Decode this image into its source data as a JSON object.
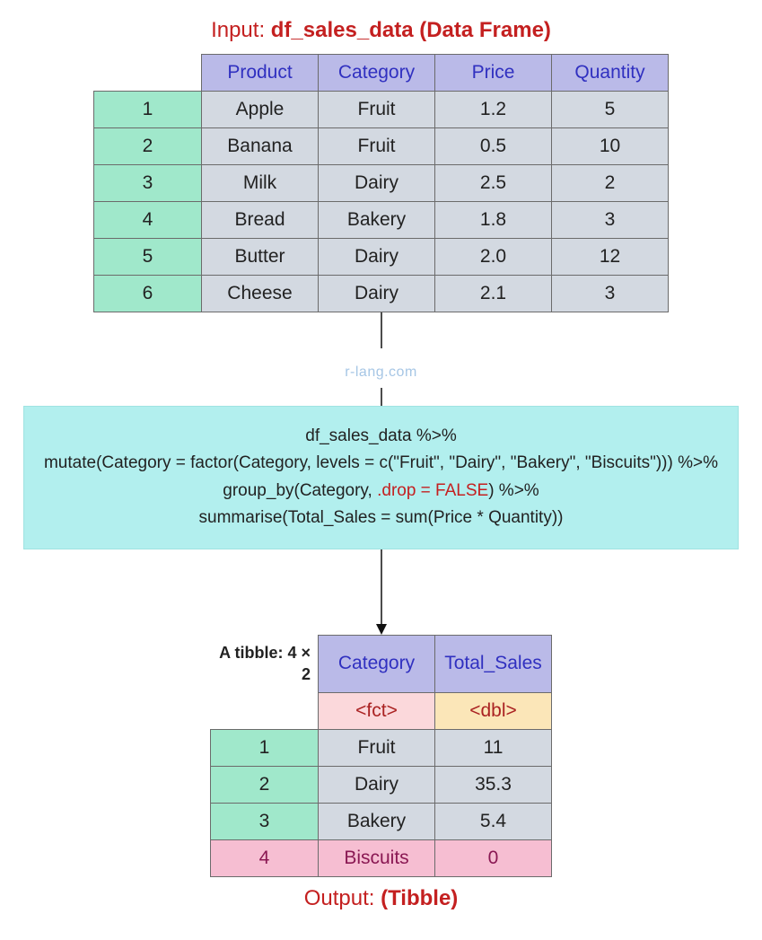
{
  "input": {
    "label": "Input: ",
    "name": "df_sales_data (Data Frame)",
    "headers": [
      "Product",
      "Category",
      "Price",
      "Quantity"
    ],
    "rows": [
      {
        "idx": "1",
        "cells": [
          "Apple",
          "Fruit",
          "1.2",
          "5"
        ]
      },
      {
        "idx": "2",
        "cells": [
          "Banana",
          "Fruit",
          "0.5",
          "10"
        ]
      },
      {
        "idx": "3",
        "cells": [
          "Milk",
          "Dairy",
          "2.5",
          "2"
        ]
      },
      {
        "idx": "4",
        "cells": [
          "Bread",
          "Bakery",
          "1.8",
          "3"
        ]
      },
      {
        "idx": "5",
        "cells": [
          "Butter",
          "Dairy",
          "2.0",
          "12"
        ]
      },
      {
        "idx": "6",
        "cells": [
          "Cheese",
          "Dairy",
          "2.1",
          "3"
        ]
      }
    ]
  },
  "watermark": "r-lang.com",
  "code": {
    "l1": "df_sales_data %>%",
    "l2a": "mutate(Category = factor(Category, levels = c(\"Fruit\", \"Dairy\", \"Bakery\", \"Biscuits\"))) %>%",
    "l3a": "group_by(Category, ",
    "l3b": ".drop = FALSE",
    "l3c": ") %>%",
    "l4": "summarise(Total_Sales = sum(Price * Quantity))"
  },
  "output": {
    "tibble_label": "A tibble: 4 × 2",
    "headers": [
      "Category",
      "Total_Sales"
    ],
    "types": [
      "<fct>",
      "<dbl>"
    ],
    "rows": [
      {
        "idx": "1",
        "cells": [
          "Fruit",
          "11"
        ],
        "pink": false
      },
      {
        "idx": "2",
        "cells": [
          "Dairy",
          "35.3"
        ],
        "pink": false
      },
      {
        "idx": "3",
        "cells": [
          "Bakery",
          "5.4"
        ],
        "pink": false
      },
      {
        "idx": "4",
        "cells": [
          "Biscuits",
          "0"
        ],
        "pink": true
      }
    ],
    "label": "Output: ",
    "name": "(Tibble)"
  }
}
